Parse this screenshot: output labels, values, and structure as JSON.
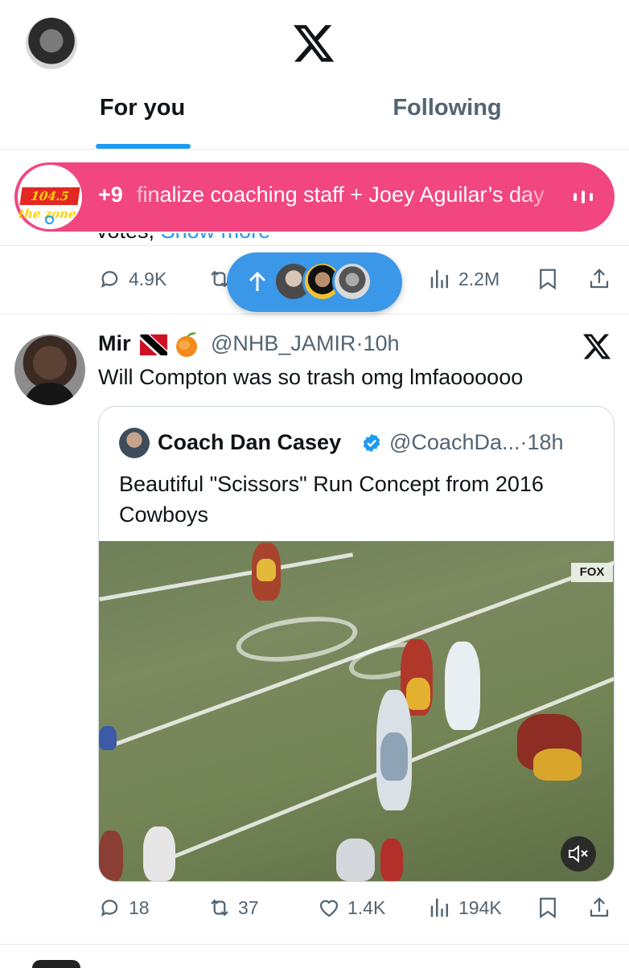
{
  "header": {
    "avatar": "user-avatar",
    "logo": "x-logo",
    "tabs": [
      {
        "label": "For you",
        "selected": true
      },
      {
        "label": "Following",
        "selected": false
      }
    ]
  },
  "live_banner": {
    "count": "+9",
    "text": "finalize coaching staff + Joey Aguilar’s day",
    "logo_text": "104.5 the zone",
    "color": "#f1467f"
  },
  "previous_tweet": {
    "clipped_text": "votes,",
    "clipped_link": "Show more",
    "replies": "4.9K",
    "views": "2.2M"
  },
  "new_posts_pill": {
    "icon": "arrow-up-icon",
    "avatars": 3,
    "color": "#3b97e7"
  },
  "tweet": {
    "name": "Mir",
    "handle": "@NHB_JAMIR",
    "separator": "·",
    "time": "10h",
    "text": "Will Compton was so trash omg lmfaoooooo",
    "quoted": {
      "name": "Coach Dan Casey",
      "handle": "@CoachDa...",
      "separator": "·",
      "time": "18h",
      "text": "Beautiful \"Scissors\" Run Concept from 2016 Cowboys",
      "media_badge": "FOX"
    },
    "actions": {
      "replies": "18",
      "reposts": "37",
      "likes": "1.4K",
      "views": "194K"
    }
  },
  "colors": {
    "accent": "#1d9bf0",
    "secondary_text": "#536471"
  }
}
